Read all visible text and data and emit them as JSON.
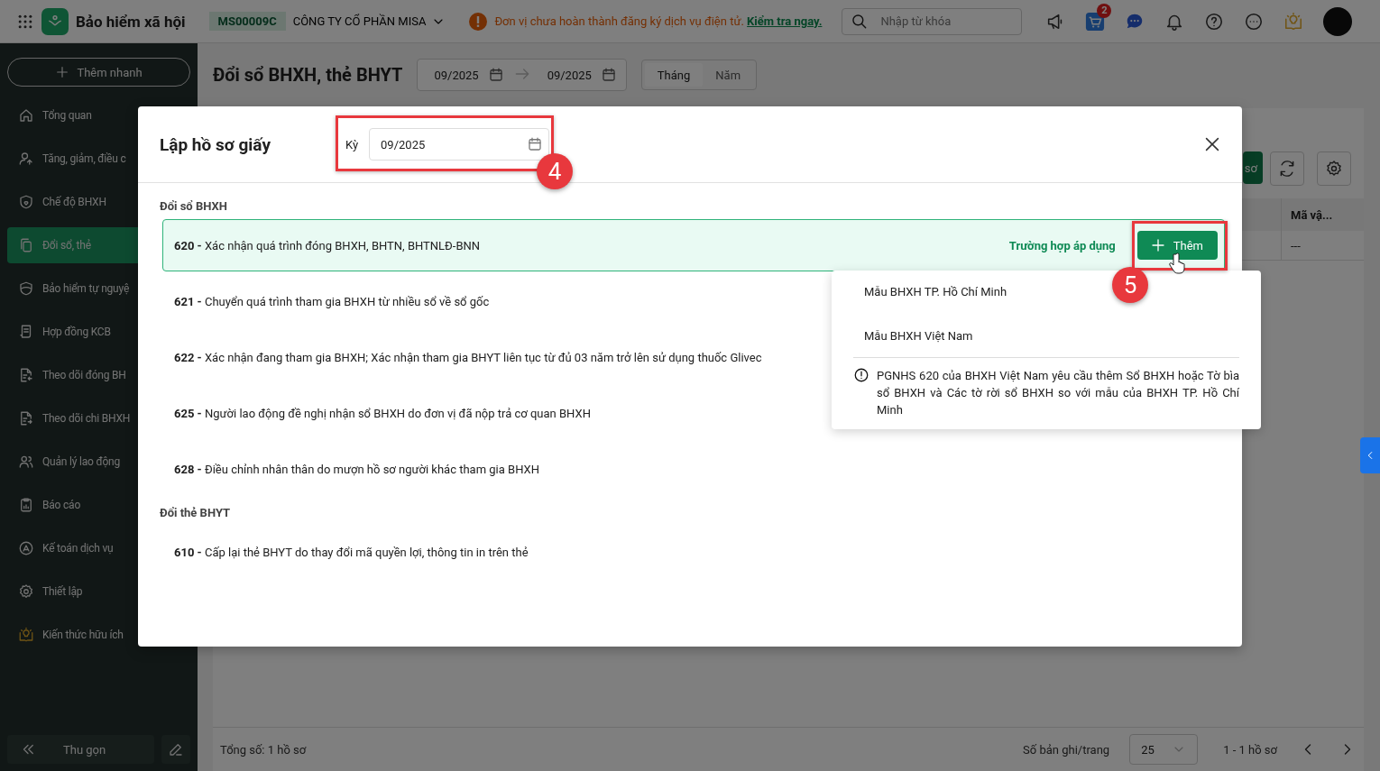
{
  "topbar": {
    "app_name": "Bảo hiểm xã hội",
    "company_code": "MS00009C",
    "company_name": "CÔNG TY CỔ PHẦN MISA",
    "notice": {
      "text": "Đơn vị chưa hoàn thành đăng ký dịch vụ điện tử.",
      "link": "Kiểm tra ngay."
    },
    "search": {
      "placeholder": "Nhập từ khóa"
    },
    "cart_badge": "2"
  },
  "sidebar": {
    "quick_add": "Thêm nhanh",
    "items": [
      {
        "label": "Tổng quan",
        "selected": false
      },
      {
        "label": "Tăng, giảm, điều c",
        "selected": false
      },
      {
        "label": "Chế độ BHXH",
        "selected": false
      },
      {
        "label": "Đổi sổ, thẻ",
        "selected": true
      },
      {
        "label": "Bảo hiểm tự nguyệ",
        "selected": false
      },
      {
        "label": "Hợp đồng KCB",
        "selected": false
      },
      {
        "label": "Theo dõi đóng BH",
        "selected": false
      },
      {
        "label": "Theo dõi chi BHXH",
        "selected": false
      },
      {
        "label": "Quản lý lao động",
        "selected": false
      },
      {
        "label": "Báo cáo",
        "selected": false
      },
      {
        "label": "Kế toán dịch vụ",
        "selected": false
      },
      {
        "label": "Thiết lập",
        "selected": false
      },
      {
        "label": "Kiến thức hữu ích",
        "selected": false
      }
    ],
    "collapse": "Thu gọn"
  },
  "page": {
    "title": "Đổi sổ BHXH, thẻ BHYT",
    "date_from": "09/2025",
    "date_to": "09/2025",
    "periods": [
      {
        "label": "Tháng",
        "selected": true
      },
      {
        "label": "Năm",
        "selected": false
      }
    ],
    "toolbar_button": "sơ",
    "table": {
      "columns": [
        "Mã vậ..."
      ],
      "rows": [
        [
          "---"
        ]
      ]
    },
    "footer": {
      "total": "Tổng số: 1 hồ sơ",
      "page_size_label": "Số bản ghi/trang",
      "page_size": "25",
      "range": "1 - 1 hồ sơ"
    }
  },
  "dialog": {
    "title": "Lập hồ sơ giấy",
    "period_label": "Kỳ",
    "period_value": "09/2025",
    "sections": [
      {
        "heading": "Đổi sổ BHXH",
        "rows": [
          {
            "text": "**620 -** Xác nhận quá trình đóng BHXH, BHTN, BHTNLĐ-BNN",
            "selected": true,
            "link": "Trường hợp áp dụng",
            "button": "Thêm"
          },
          {
            "text": "**621 -** Chuyển quá trình tham gia BHXH từ nhiều sổ về sổ gốc",
            "selected": false
          },
          {
            "text": "**622 -** Xác nhận đang tham gia BHXH; Xác nhận tham gia BHYT liên tục từ đủ 03 năm trở lên sử dụng thuốc Glivec",
            "selected": false
          },
          {
            "text": "**625 -** Người lao động đề nghị nhận sổ BHXH do đơn vị đã nộp trả cơ quan BHXH",
            "selected": false
          },
          {
            "text": "**628 -** Điều chỉnh nhân thân do mượn hồ sơ người khác tham gia BHXH",
            "selected": false
          }
        ]
      },
      {
        "heading": "Đổi thẻ BHYT",
        "rows": [
          {
            "text": "**610 -** Cấp lại thẻ BHYT do thay đổi mã quyền lợi, thông tin in trên thẻ",
            "selected": false
          }
        ]
      }
    ],
    "menu": {
      "items": [
        "Mẫu BHXH TP. Hồ Chí Minh",
        "Mẫu BHXH Việt Nam"
      ],
      "note": "PGNHS 620 của BHXH Việt Nam yêu cầu thêm Sổ BHXH hoặc Tờ bìa sổ BHXH và Các tờ rời sổ BHXH so với mẫu của BHXH TP. Hồ Chí Minh"
    }
  },
  "annotations": [
    "4",
    "5"
  ]
}
